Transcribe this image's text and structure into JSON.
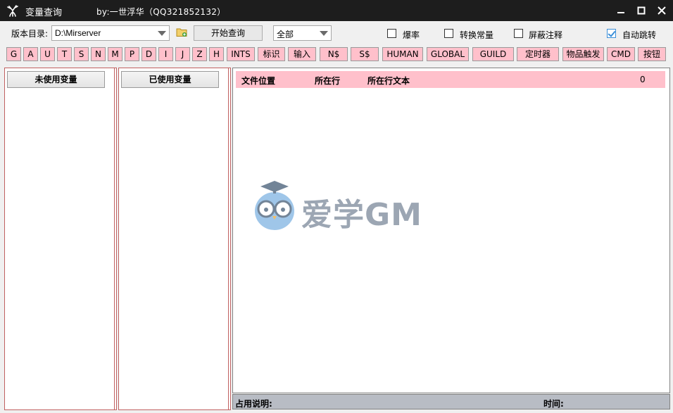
{
  "window": {
    "title": "变量查询",
    "byline": "by:一世浮华（QQ321852132）",
    "icon": "antler-icon",
    "controls": [
      "minimize-icon",
      "maximize-icon",
      "close-icon"
    ]
  },
  "toolbar": {
    "version_label": "版本目录:",
    "path_value": "D:\\Mirserver",
    "start_label": "开始查询",
    "scope_value": "全部",
    "checkboxes": [
      {
        "label": "爆率",
        "checked": false
      },
      {
        "label": "转换常量",
        "checked": false
      },
      {
        "label": "屏蔽注释",
        "checked": false
      },
      {
        "label": "自动跳转",
        "checked": true
      }
    ]
  },
  "filter_buttons": [
    "G",
    "A",
    "U",
    "T",
    "S",
    "N",
    "M",
    "P",
    "D",
    "I",
    "J",
    "Z",
    "H",
    "INTS",
    "标识",
    "输入",
    "N$",
    "S$",
    "HUMAN",
    "GLOBAL",
    "GUILD",
    "定时器",
    "物品触发",
    "CMD",
    "按钮"
  ],
  "panels": {
    "unused_header": "未使用变量",
    "used_header": "已使用变量"
  },
  "results": {
    "col_file": "文件位置",
    "col_line": "所在行",
    "col_text": "所在行文本",
    "count": "0"
  },
  "status": {
    "usage_label": "占用说明:",
    "time_label": "时间:"
  },
  "watermark": {
    "text": "爱学GM",
    "icon": "owl-logo-icon"
  },
  "colors": {
    "titlebar": "#1d1d1d",
    "button_pink": "#ffc0cb",
    "status_gray": "#b8bcc4",
    "checkbox_accent": "#3b8fd8"
  }
}
